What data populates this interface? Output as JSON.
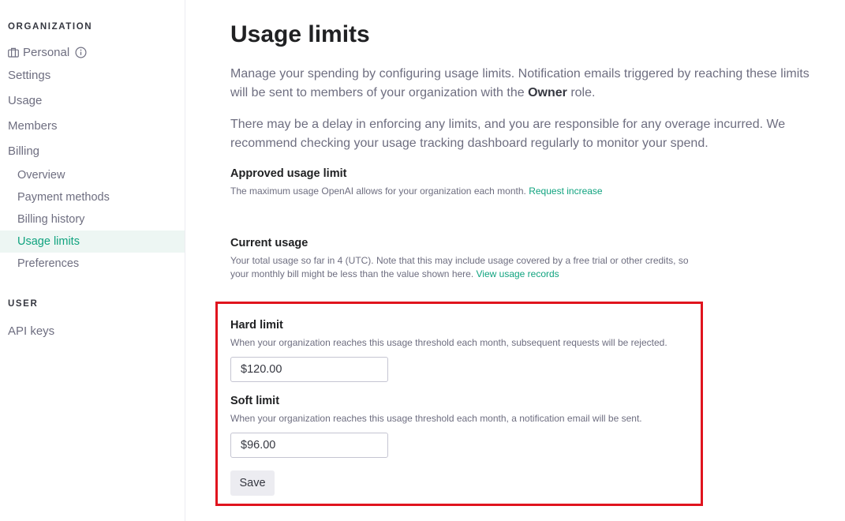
{
  "sidebar": {
    "org_header": "ORGANIZATION",
    "org_name": "Personal",
    "items": [
      {
        "label": "Settings"
      },
      {
        "label": "Usage"
      },
      {
        "label": "Members"
      },
      {
        "label": "Billing"
      }
    ],
    "billing_items": [
      {
        "label": "Overview",
        "active": false
      },
      {
        "label": "Payment methods",
        "active": false
      },
      {
        "label": "Billing history",
        "active": false
      },
      {
        "label": "Usage limits",
        "active": true
      },
      {
        "label": "Preferences",
        "active": false
      }
    ],
    "user_header": "USER",
    "user_items": [
      {
        "label": "API keys"
      }
    ]
  },
  "main": {
    "title": "Usage limits",
    "intro_1_before": "Manage your spending by configuring usage limits. Notification emails triggered by reaching these limits will be sent to members of your organization with the ",
    "intro_1_bold": "Owner",
    "intro_1_after": " role.",
    "intro_2": "There may be a delay in enforcing any limits, and you are responsible for any overage incurred. We recommend checking your usage tracking dashboard regularly to monitor your spend.",
    "approved": {
      "label": "Approved usage limit",
      "desc": "The maximum usage OpenAI allows for your organization each month.",
      "link": "Request increase"
    },
    "current": {
      "label": "Current usage",
      "desc": "Your total usage so far in 4 (UTC). Note that this may include usage covered by a free trial or other credits, so your monthly bill might be less than the value shown here.",
      "link": "View usage records"
    },
    "hard_limit": {
      "label": "Hard limit",
      "desc": "When your organization reaches this usage threshold each month, subsequent requests will be rejected.",
      "value": "$120.00"
    },
    "soft_limit": {
      "label": "Soft limit",
      "desc": "When your organization reaches this usage threshold each month, a notification email will be sent.",
      "value": "$96.00"
    },
    "save_label": "Save"
  },
  "colors": {
    "accent": "#10a37f",
    "active_bg": "#edf6f3",
    "highlight_border": "#e0141e"
  }
}
